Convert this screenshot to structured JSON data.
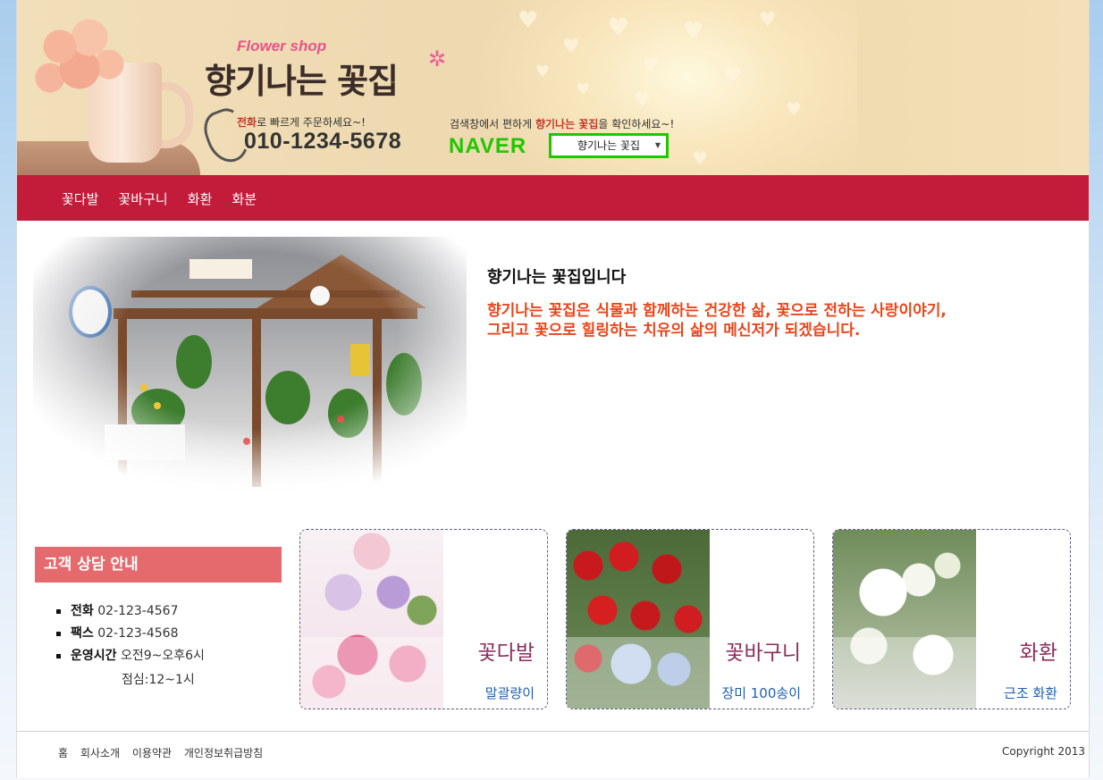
{
  "header": {
    "logo_en": "Flower shop",
    "logo_ko": "향기나는 꽃집",
    "phone_msg_bold": "전화",
    "phone_msg_rest": "로 빠르게 주문하세요~!",
    "phone_number": "010-1234-5678",
    "search_msg_pre": "검색창에서 편하게 ",
    "search_msg_bold": "향기나는 꽃집",
    "search_msg_post": "을 확인하세요~!",
    "naver": "NAVER",
    "search_box_value": "향기나는 꽃집"
  },
  "nav": {
    "items": [
      "꽃다발",
      "꽃바구니",
      "화환",
      "화분"
    ]
  },
  "hero": {
    "title": "향기나는 꽃집입니다",
    "desc_line1": "향기나는 꽃집은 식물과 함께하는 건강한 삶, 꽃으로 전하는 사랑이야기,",
    "desc_line2": "그리고 꽃으로 힐링하는 치유의 삶의 메신저가 되겠습니다."
  },
  "consult": {
    "title": "고객 상담 안내",
    "items": [
      {
        "label": "전화",
        "value": "02-123-4567"
      },
      {
        "label": "팩스",
        "value": "02-123-4568"
      },
      {
        "label": "운영시간",
        "value": "오전9~오후6시"
      }
    ],
    "lunch": "점심:12~1시"
  },
  "cards": [
    {
      "title": "꽃다발",
      "sub": "말괄량이"
    },
    {
      "title": "꽃바구니",
      "sub": "장미 100송이"
    },
    {
      "title": "화환",
      "sub": "근조 화환"
    }
  ],
  "footer": {
    "links": [
      "홈",
      "회사소개",
      "이용약관",
      "개인정보취급방침"
    ],
    "copyright": "Copyright 2013"
  },
  "colors": {
    "nav_bg": "#c31b3a",
    "consult_head_bg": "#e46a6e",
    "hero_desc": "#e8461b",
    "card_title": "#8b2f5c",
    "card_sub": "#1f5fb0",
    "naver_green": "#1ec800"
  }
}
